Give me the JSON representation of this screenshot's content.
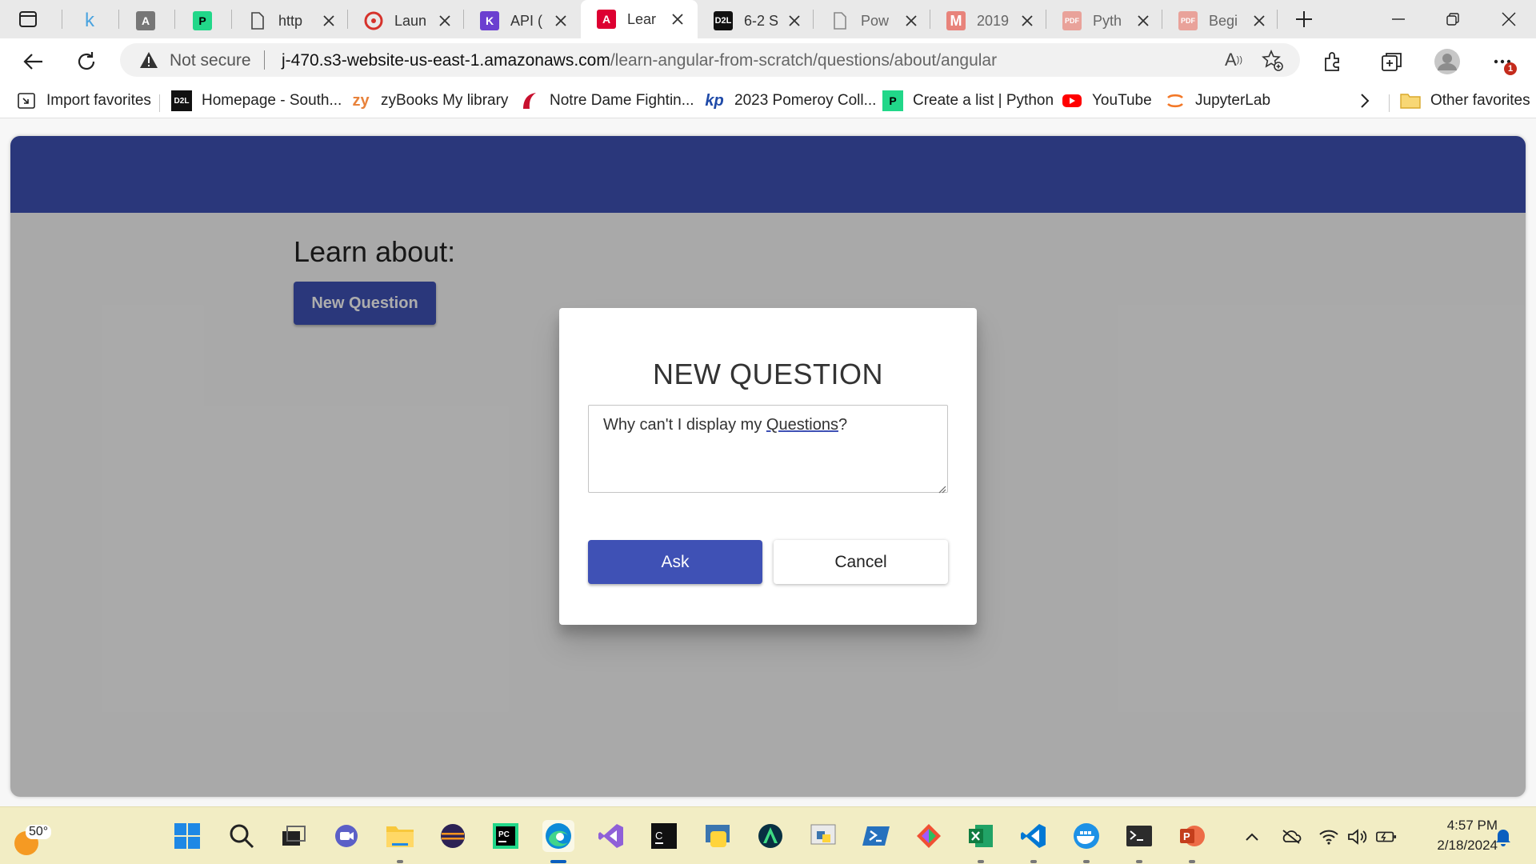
{
  "browser": {
    "tabs": [
      {
        "label": "",
        "icon": "k-logo-icon"
      },
      {
        "label": "",
        "icon": "angular-outline-icon"
      },
      {
        "label": "",
        "icon": "pycharm-icon"
      },
      {
        "label": "http",
        "icon": "page-icon"
      },
      {
        "label": "Laun",
        "icon": "launchpad-icon"
      },
      {
        "label": "API (",
        "icon": "api-icon"
      },
      {
        "label": "Lear",
        "icon": "angular-icon",
        "active": true
      },
      {
        "label": "6-2 S",
        "icon": "d2l-icon"
      },
      {
        "label": "Pow",
        "icon": "page-icon"
      },
      {
        "label": "2019",
        "icon": "m-logo-icon"
      },
      {
        "label": "Pyth",
        "icon": "pdf-icon"
      },
      {
        "label": "Begi",
        "icon": "pdf-icon"
      }
    ],
    "address": {
      "security_label": "Not secure",
      "url_host": "j-470.s3-website-us-east-1.amazonaws.com",
      "url_path": "/learn-angular-from-scratch/questions/about/angular"
    },
    "notification_count": "1",
    "bookmarks": [
      {
        "label": "Import favorites",
        "icon": "import-icon"
      },
      {
        "label": "Homepage - South...",
        "icon": "d2l-icon"
      },
      {
        "label": "zyBooks My library",
        "icon": "zybooks-icon"
      },
      {
        "label": "Notre Dame Fightin...",
        "icon": "notre-dame-icon"
      },
      {
        "label": "2023 Pomeroy Coll...",
        "icon": "kp-icon"
      },
      {
        "label": "Create a list | Python",
        "icon": "pycharm-icon"
      },
      {
        "label": "YouTube",
        "icon": "youtube-icon"
      },
      {
        "label": "JupyterLab",
        "icon": "jupyter-icon"
      }
    ],
    "other_favorites": "Other favorites"
  },
  "page": {
    "heading": "Learn about:",
    "new_question_button": "New Question",
    "dialog": {
      "title": "NEW QUESTION",
      "question_before": "Why can't I display my ",
      "question_link": "Questions",
      "question_after": "?",
      "ask_label": "Ask",
      "cancel_label": "Cancel"
    },
    "colors": {
      "primary": "#3f51b5"
    }
  },
  "taskbar": {
    "weather_temp": "50°",
    "time": "4:57 PM",
    "date": "2/18/2024"
  }
}
